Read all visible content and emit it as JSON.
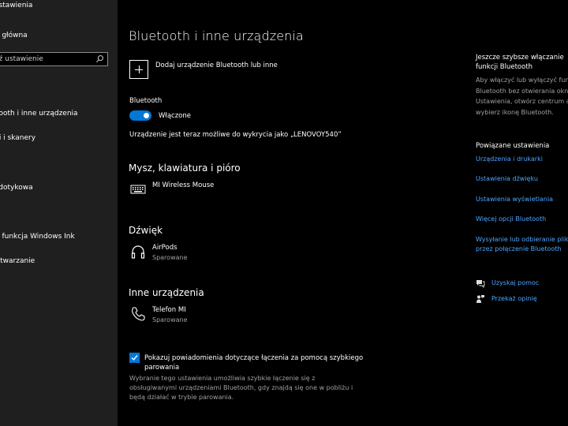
{
  "sidebar": {
    "app_title": "Ustawienia",
    "home": "Strona główna",
    "search_placeholder": "Znajdź ustawienie",
    "items": [
      "Bluetooth i inne urządzenia",
      "Drukarki i skanery",
      "Płytka dotykowa",
      "Pióro i funkcja Windows Ink",
      "Autoodtwarzanie"
    ]
  },
  "main": {
    "title": "Bluetooth i inne urządzenia",
    "add_device_label": "Dodaj urządzenie Bluetooth lub inne",
    "bluetooth_label": "Bluetooth",
    "bluetooth_state": "Włączone",
    "discoverable_text": "Urządzenie jest teraz możliwe do wykrycia jako „LENOVOY540”",
    "sections": {
      "mouse": {
        "heading": "Mysz, klawiatura i pióro",
        "devices": [
          {
            "name": "MI Wireless Mouse",
            "status": ""
          }
        ]
      },
      "audio": {
        "heading": "Dźwięk",
        "devices": [
          {
            "name": "AirPods",
            "status": "Sparowane"
          }
        ]
      },
      "other": {
        "heading": "Inne urządzenia",
        "devices": [
          {
            "name": "Telefon MI",
            "status": "Sparowane"
          }
        ]
      }
    },
    "swift_pair_checkbox_label": "Pokazuj powiadomienia dotyczące łączenia za pomocą szybkiego parowania",
    "swift_pair_checked": true,
    "swift_pair_description": "Wybranie tego ustawienia umożliwia szybkie łączenie się z obsługiwanymi urządzeniami Bluetooth, gdy znajdą się one w pobliżu i będą działać w trybie parowania."
  },
  "right": {
    "tip_title": "Jeszcze szybsze włączanie funkcji Bluetooth",
    "tip_body": "Aby włączyć lub wyłączyć funkcję Bluetooth bez otwierania okna Ustawienia, otwórz centrum akcji i wybierz ikonę Bluetooth.",
    "related_heading": "Powiązane ustawienia",
    "related_links": [
      "Urządzenia i drukarki",
      "Ustawienia dźwięku",
      "Ustawienia wyświetlania",
      "Więcej opcji Bluetooth",
      "Wysyłanie lub odbieranie plików przez połączenie Bluetooth"
    ],
    "help_link": "Uzyskaj pomoc",
    "feedback_link": "Przekaż opinię"
  },
  "colors": {
    "accent": "#0078d7",
    "link": "#4ea5ff",
    "sidebar_bg": "#1f1f1f",
    "main_bg": "#000000"
  },
  "icons": {
    "search": "search-icon",
    "add": "plus-icon",
    "keyboard": "keyboard-icon",
    "headphones": "headphones-icon",
    "phone": "phone-icon",
    "help": "help-chat-icon",
    "feedback": "feedback-person-icon"
  }
}
